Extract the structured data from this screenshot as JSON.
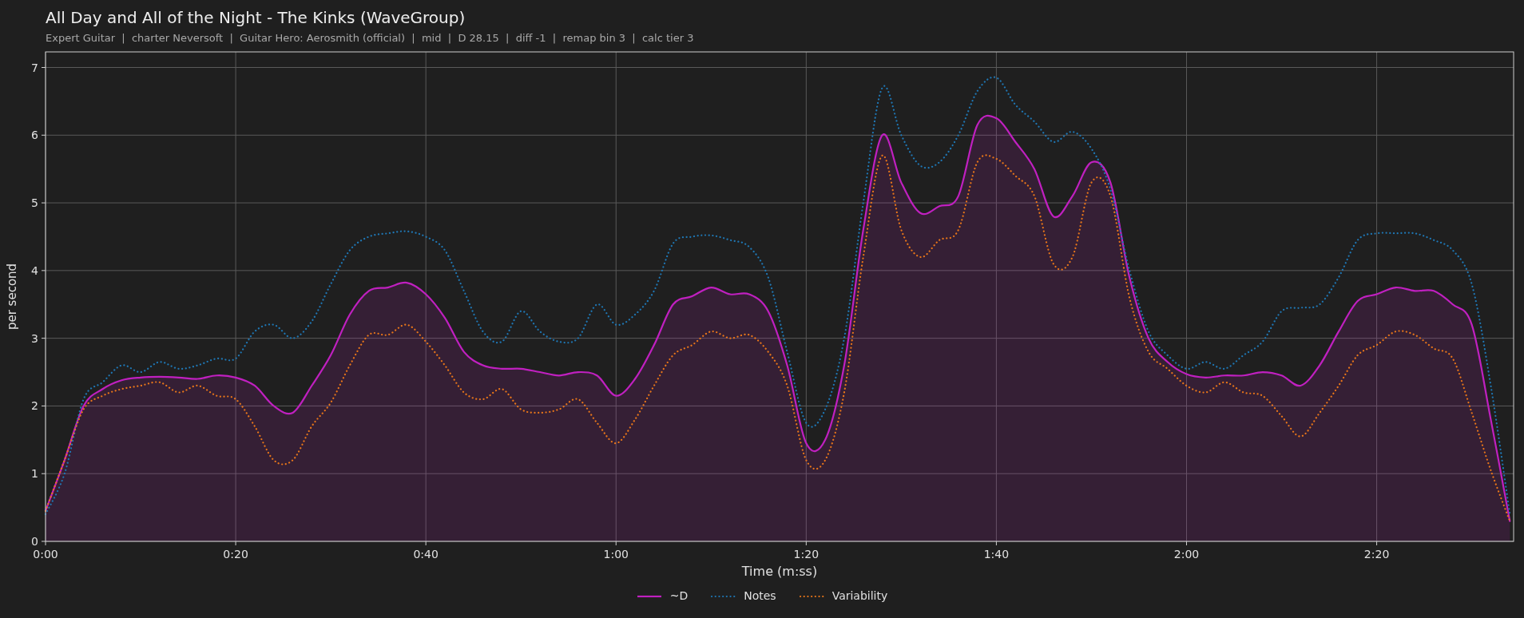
{
  "title": "All Day and All of the Night - The Kinks (WaveGroup)",
  "subtitle": "Expert Guitar  |  charter Neversoft  |  Guitar Hero: Aerosmith (official)  |  mid  |  D 28.15  |  diff -1  |  remap bin 3  |  calc tier 3",
  "chart": {
    "chart_data": {
      "type": "line",
      "xlabel": "Time (m:ss)",
      "ylabel": "per second",
      "x": [
        0,
        2,
        4,
        6,
        8,
        10,
        12,
        14,
        16,
        18,
        20,
        22,
        24,
        26,
        28,
        30,
        32,
        34,
        36,
        38,
        40,
        42,
        44,
        46,
        48,
        50,
        52,
        54,
        56,
        58,
        60,
        62,
        64,
        66,
        68,
        70,
        72,
        74,
        76,
        78,
        80,
        82,
        84,
        86,
        88,
        90,
        92,
        94,
        96,
        98,
        100,
        102,
        104,
        106,
        108,
        110,
        112,
        114,
        116,
        118,
        120,
        122,
        124,
        126,
        128,
        130,
        132,
        134,
        136,
        138,
        140,
        142,
        144,
        146,
        148,
        150,
        152,
        154
      ],
      "series": [
        {
          "name": "~D",
          "color": "#c020c0",
          "type": "area",
          "line_style": "solid",
          "values": [
            0.45,
            1.2,
            2.0,
            2.25,
            2.38,
            2.42,
            2.43,
            2.42,
            2.4,
            2.45,
            2.42,
            2.3,
            2.0,
            1.9,
            2.3,
            2.75,
            3.35,
            3.7,
            3.75,
            3.82,
            3.65,
            3.3,
            2.8,
            2.6,
            2.55,
            2.55,
            2.5,
            2.45,
            2.5,
            2.45,
            2.15,
            2.4,
            2.9,
            3.5,
            3.62,
            3.75,
            3.65,
            3.65,
            3.4,
            2.6,
            1.45,
            1.5,
            2.6,
            4.6,
            6.0,
            5.3,
            4.85,
            4.95,
            5.1,
            6.15,
            6.25,
            5.9,
            5.5,
            4.8,
            5.1,
            5.6,
            5.3,
            3.9,
            3.0,
            2.65,
            2.47,
            2.42,
            2.45,
            2.45,
            2.5,
            2.45,
            2.3,
            2.6,
            3.1,
            3.55,
            3.65,
            3.75,
            3.7,
            3.7,
            3.5,
            3.2,
            1.8,
            0.3
          ]
        },
        {
          "name": "Notes",
          "color": "#1f77b4",
          "type": "line",
          "line_style": "dotted",
          "values": [
            0.4,
            1.0,
            2.1,
            2.35,
            2.6,
            2.5,
            2.65,
            2.55,
            2.6,
            2.7,
            2.7,
            3.1,
            3.2,
            3.0,
            3.25,
            3.8,
            4.3,
            4.5,
            4.55,
            4.58,
            4.5,
            4.3,
            3.7,
            3.1,
            2.95,
            3.4,
            3.1,
            2.95,
            3.0,
            3.5,
            3.2,
            3.35,
            3.7,
            4.4,
            4.5,
            4.52,
            4.45,
            4.35,
            3.9,
            2.8,
            1.75,
            1.95,
            3.0,
            5.0,
            6.7,
            6.0,
            5.55,
            5.6,
            6.0,
            6.65,
            6.85,
            6.45,
            6.2,
            5.9,
            6.05,
            5.8,
            5.2,
            4.0,
            3.1,
            2.75,
            2.55,
            2.65,
            2.55,
            2.75,
            2.95,
            3.4,
            3.45,
            3.5,
            3.9,
            4.45,
            4.55,
            4.55,
            4.55,
            4.45,
            4.3,
            3.8,
            2.3,
            0.4
          ]
        },
        {
          "name": "Variability",
          "color": "#e8761a",
          "type": "line",
          "line_style": "dotted",
          "values": [
            0.45,
            1.2,
            1.95,
            2.15,
            2.25,
            2.3,
            2.35,
            2.2,
            2.3,
            2.15,
            2.1,
            1.7,
            1.2,
            1.2,
            1.7,
            2.05,
            2.6,
            3.05,
            3.05,
            3.2,
            2.95,
            2.6,
            2.2,
            2.1,
            2.25,
            1.95,
            1.9,
            1.95,
            2.1,
            1.75,
            1.45,
            1.8,
            2.3,
            2.75,
            2.9,
            3.1,
            3.0,
            3.05,
            2.8,
            2.3,
            1.2,
            1.2,
            2.2,
            4.2,
            5.7,
            4.6,
            4.2,
            4.45,
            4.6,
            5.6,
            5.65,
            5.4,
            5.1,
            4.1,
            4.2,
            5.3,
            5.1,
            3.6,
            2.8,
            2.55,
            2.3,
            2.2,
            2.35,
            2.2,
            2.15,
            1.85,
            1.55,
            1.9,
            2.3,
            2.75,
            2.9,
            3.1,
            3.05,
            2.85,
            2.7,
            1.9,
            1.05,
            0.3
          ]
        }
      ],
      "xlim": [
        0,
        154.4
      ],
      "ylim": [
        0,
        7.23
      ],
      "xticks": [
        {
          "value": 0,
          "label": "0:00"
        },
        {
          "value": 20,
          "label": "0:20"
        },
        {
          "value": 40,
          "label": "0:40"
        },
        {
          "value": 60,
          "label": "1:00"
        },
        {
          "value": 80,
          "label": "1:20"
        },
        {
          "value": 100,
          "label": "1:40"
        },
        {
          "value": 120,
          "label": "2:00"
        },
        {
          "value": 140,
          "label": "2:20"
        }
      ],
      "yticks": [
        0,
        1,
        2,
        3,
        4,
        5,
        6,
        7
      ],
      "grid": true
    }
  }
}
